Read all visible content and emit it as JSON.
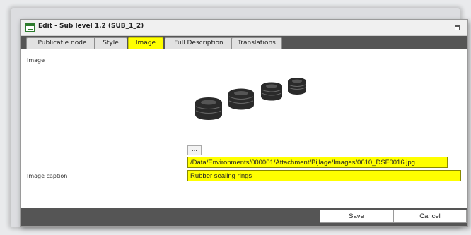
{
  "window": {
    "title": "Edit - Sub level 1.2 (SUB_1_2)"
  },
  "tabs": [
    {
      "label": "Publicatie node",
      "active": false
    },
    {
      "label": "Style",
      "active": false
    },
    {
      "label": "Image",
      "active": true
    },
    {
      "label": "Full Description",
      "active": false
    },
    {
      "label": "Translations",
      "active": false
    }
  ],
  "image_section": {
    "label": "Image",
    "preview_icon": "rubber-rings-image",
    "browse_label": "...",
    "path_value": "/Data/Environments/000001/Attachment/Bijlage/Images/0610_DSF0016.jpg"
  },
  "caption_section": {
    "label": "Image caption",
    "value": "Rubber sealing rings"
  },
  "footer": {
    "save_label": "Save",
    "cancel_label": "Cancel"
  },
  "colors": {
    "highlight": "#ffff00",
    "bar": "#555555"
  }
}
